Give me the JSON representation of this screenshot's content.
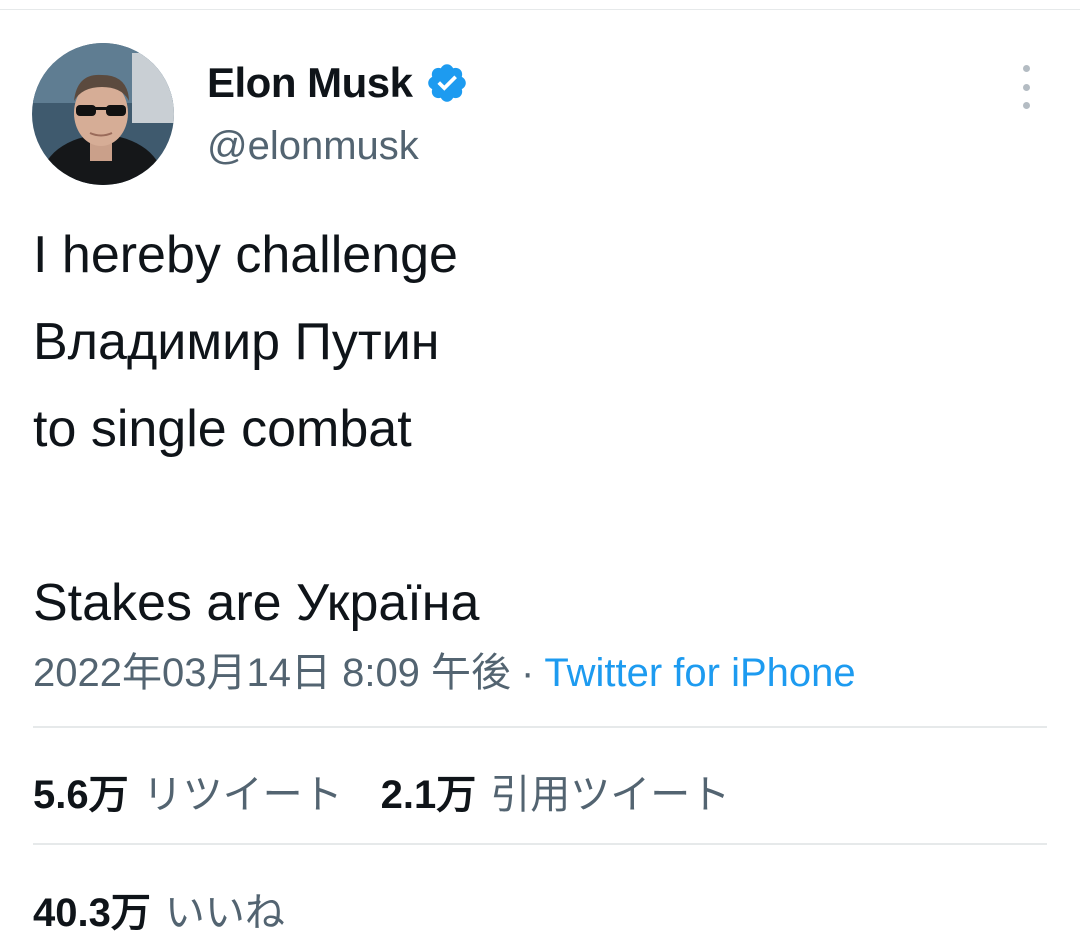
{
  "author": {
    "display_name": "Elon Musk",
    "handle": "@elonmusk",
    "verified_icon": "verified-badge-icon",
    "avatar_description": "avatar-photo"
  },
  "tweet": {
    "lines": [
      "I hereby challenge",
      "Владимир Путин",
      "to single combat",
      "",
      "Stakes are Україна"
    ]
  },
  "meta": {
    "timestamp": "2022年03月14日 8:09 午後",
    "separator": "·",
    "source": "Twitter for iPhone"
  },
  "stats": {
    "retweets_count": "5.6万",
    "retweets_label": "リツイート",
    "quotes_count": "2.1万",
    "quotes_label": "引用ツイート",
    "likes_count": "40.3万",
    "likes_label": "いいね"
  },
  "colors": {
    "text_primary": "#0f1419",
    "text_secondary": "#536471",
    "link": "#1d9bf0",
    "verified": "#1d9bf0",
    "divider": "#e6e9ea"
  }
}
